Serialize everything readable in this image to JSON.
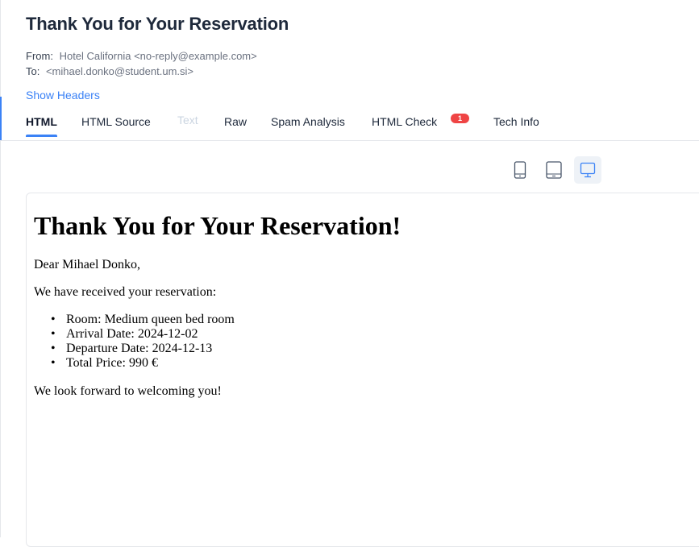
{
  "email": {
    "subject": "Thank You for Your Reservation",
    "from_label": "From:",
    "from_value": "Hotel California <no-reply@example.com>",
    "to_label": "To:",
    "to_value": "<mihael.donko@student.um.si>",
    "show_headers": "Show Headers"
  },
  "tabs": [
    {
      "label": "HTML",
      "state": "active"
    },
    {
      "label": "HTML Source",
      "state": "normal"
    },
    {
      "label": "Text",
      "state": "disabled"
    },
    {
      "label": "Raw",
      "state": "normal"
    },
    {
      "label": "Spam Analysis",
      "state": "normal"
    },
    {
      "label": "HTML Check",
      "state": "normal",
      "badge": "1"
    },
    {
      "label": "Tech Info",
      "state": "normal"
    }
  ],
  "device_toggle": {
    "options": [
      {
        "icon": "mobile-icon",
        "active": false
      },
      {
        "icon": "tablet-icon",
        "active": false
      },
      {
        "icon": "desktop-icon",
        "active": true
      }
    ],
    "active_color": "#3b82f6"
  },
  "preview": {
    "heading": "Thank You for Your Reservation!",
    "greeting": "Dear Mihael Donko,",
    "received": "We have received your reservation:",
    "details": [
      "Room: Medium queen bed room",
      "Arrival Date: 2024-12-02",
      "Departure Date: 2024-12-13",
      "Total Price: 990 €"
    ],
    "closing": "We look forward to welcoming you!"
  },
  "colors": {
    "accent": "#3b82f6",
    "badge": "#ef4444",
    "title": "#1e293b"
  }
}
